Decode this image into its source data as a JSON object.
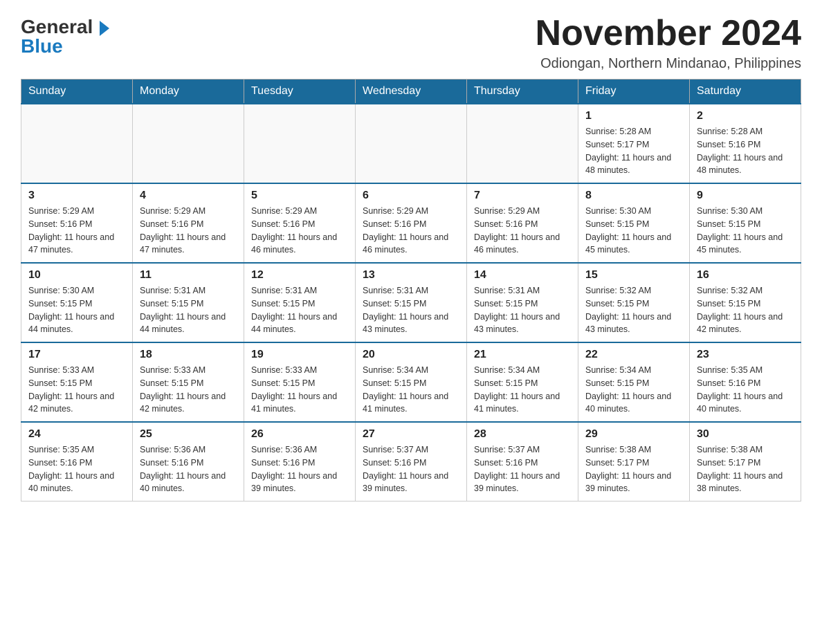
{
  "logo": {
    "general": "General",
    "blue": "Blue"
  },
  "header": {
    "month_year": "November 2024",
    "location": "Odiongan, Northern Mindanao, Philippines"
  },
  "days_of_week": [
    "Sunday",
    "Monday",
    "Tuesday",
    "Wednesday",
    "Thursday",
    "Friday",
    "Saturday"
  ],
  "weeks": [
    {
      "days": [
        {
          "num": "",
          "info": ""
        },
        {
          "num": "",
          "info": ""
        },
        {
          "num": "",
          "info": ""
        },
        {
          "num": "",
          "info": ""
        },
        {
          "num": "",
          "info": ""
        },
        {
          "num": "1",
          "info": "Sunrise: 5:28 AM\nSunset: 5:17 PM\nDaylight: 11 hours and 48 minutes."
        },
        {
          "num": "2",
          "info": "Sunrise: 5:28 AM\nSunset: 5:16 PM\nDaylight: 11 hours and 48 minutes."
        }
      ]
    },
    {
      "days": [
        {
          "num": "3",
          "info": "Sunrise: 5:29 AM\nSunset: 5:16 PM\nDaylight: 11 hours and 47 minutes."
        },
        {
          "num": "4",
          "info": "Sunrise: 5:29 AM\nSunset: 5:16 PM\nDaylight: 11 hours and 47 minutes."
        },
        {
          "num": "5",
          "info": "Sunrise: 5:29 AM\nSunset: 5:16 PM\nDaylight: 11 hours and 46 minutes."
        },
        {
          "num": "6",
          "info": "Sunrise: 5:29 AM\nSunset: 5:16 PM\nDaylight: 11 hours and 46 minutes."
        },
        {
          "num": "7",
          "info": "Sunrise: 5:29 AM\nSunset: 5:16 PM\nDaylight: 11 hours and 46 minutes."
        },
        {
          "num": "8",
          "info": "Sunrise: 5:30 AM\nSunset: 5:15 PM\nDaylight: 11 hours and 45 minutes."
        },
        {
          "num": "9",
          "info": "Sunrise: 5:30 AM\nSunset: 5:15 PM\nDaylight: 11 hours and 45 minutes."
        }
      ]
    },
    {
      "days": [
        {
          "num": "10",
          "info": "Sunrise: 5:30 AM\nSunset: 5:15 PM\nDaylight: 11 hours and 44 minutes."
        },
        {
          "num": "11",
          "info": "Sunrise: 5:31 AM\nSunset: 5:15 PM\nDaylight: 11 hours and 44 minutes."
        },
        {
          "num": "12",
          "info": "Sunrise: 5:31 AM\nSunset: 5:15 PM\nDaylight: 11 hours and 44 minutes."
        },
        {
          "num": "13",
          "info": "Sunrise: 5:31 AM\nSunset: 5:15 PM\nDaylight: 11 hours and 43 minutes."
        },
        {
          "num": "14",
          "info": "Sunrise: 5:31 AM\nSunset: 5:15 PM\nDaylight: 11 hours and 43 minutes."
        },
        {
          "num": "15",
          "info": "Sunrise: 5:32 AM\nSunset: 5:15 PM\nDaylight: 11 hours and 43 minutes."
        },
        {
          "num": "16",
          "info": "Sunrise: 5:32 AM\nSunset: 5:15 PM\nDaylight: 11 hours and 42 minutes."
        }
      ]
    },
    {
      "days": [
        {
          "num": "17",
          "info": "Sunrise: 5:33 AM\nSunset: 5:15 PM\nDaylight: 11 hours and 42 minutes."
        },
        {
          "num": "18",
          "info": "Sunrise: 5:33 AM\nSunset: 5:15 PM\nDaylight: 11 hours and 42 minutes."
        },
        {
          "num": "19",
          "info": "Sunrise: 5:33 AM\nSunset: 5:15 PM\nDaylight: 11 hours and 41 minutes."
        },
        {
          "num": "20",
          "info": "Sunrise: 5:34 AM\nSunset: 5:15 PM\nDaylight: 11 hours and 41 minutes."
        },
        {
          "num": "21",
          "info": "Sunrise: 5:34 AM\nSunset: 5:15 PM\nDaylight: 11 hours and 41 minutes."
        },
        {
          "num": "22",
          "info": "Sunrise: 5:34 AM\nSunset: 5:15 PM\nDaylight: 11 hours and 40 minutes."
        },
        {
          "num": "23",
          "info": "Sunrise: 5:35 AM\nSunset: 5:16 PM\nDaylight: 11 hours and 40 minutes."
        }
      ]
    },
    {
      "days": [
        {
          "num": "24",
          "info": "Sunrise: 5:35 AM\nSunset: 5:16 PM\nDaylight: 11 hours and 40 minutes."
        },
        {
          "num": "25",
          "info": "Sunrise: 5:36 AM\nSunset: 5:16 PM\nDaylight: 11 hours and 40 minutes."
        },
        {
          "num": "26",
          "info": "Sunrise: 5:36 AM\nSunset: 5:16 PM\nDaylight: 11 hours and 39 minutes."
        },
        {
          "num": "27",
          "info": "Sunrise: 5:37 AM\nSunset: 5:16 PM\nDaylight: 11 hours and 39 minutes."
        },
        {
          "num": "28",
          "info": "Sunrise: 5:37 AM\nSunset: 5:16 PM\nDaylight: 11 hours and 39 minutes."
        },
        {
          "num": "29",
          "info": "Sunrise: 5:38 AM\nSunset: 5:17 PM\nDaylight: 11 hours and 39 minutes."
        },
        {
          "num": "30",
          "info": "Sunrise: 5:38 AM\nSunset: 5:17 PM\nDaylight: 11 hours and 38 minutes."
        }
      ]
    }
  ]
}
